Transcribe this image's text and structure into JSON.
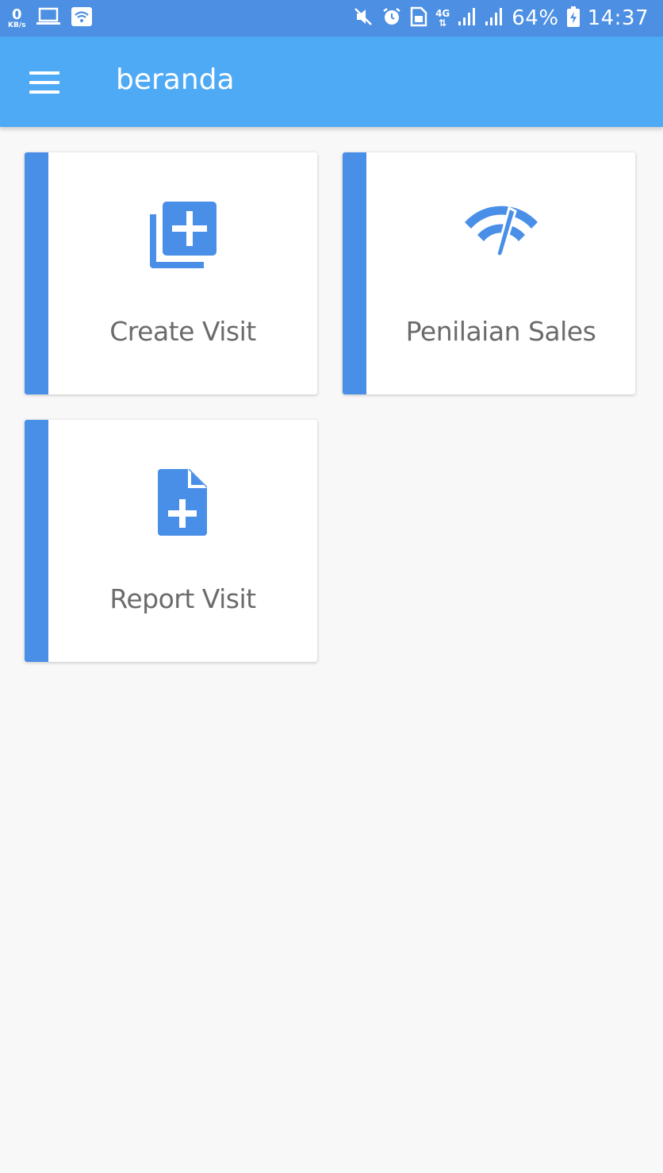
{
  "status_bar": {
    "net_speed_value": "0",
    "net_speed_unit": "KB/s",
    "network_type": "4G",
    "battery_percent": "64%",
    "time": "14:37"
  },
  "app_bar": {
    "title": "beranda"
  },
  "menu_cards": [
    {
      "label": "Create Visit",
      "icon": "add-to-photos-icon"
    },
    {
      "label": "Penilaian Sales",
      "icon": "speedometer-icon"
    },
    {
      "label": "Report Visit",
      "icon": "note-add-icon"
    }
  ],
  "colors": {
    "status_bar": "#4c8fe3",
    "app_bar": "#4faaf5",
    "accent": "#4a8fe7",
    "background": "#f8f8f8",
    "card_label": "#6b6b6b"
  }
}
